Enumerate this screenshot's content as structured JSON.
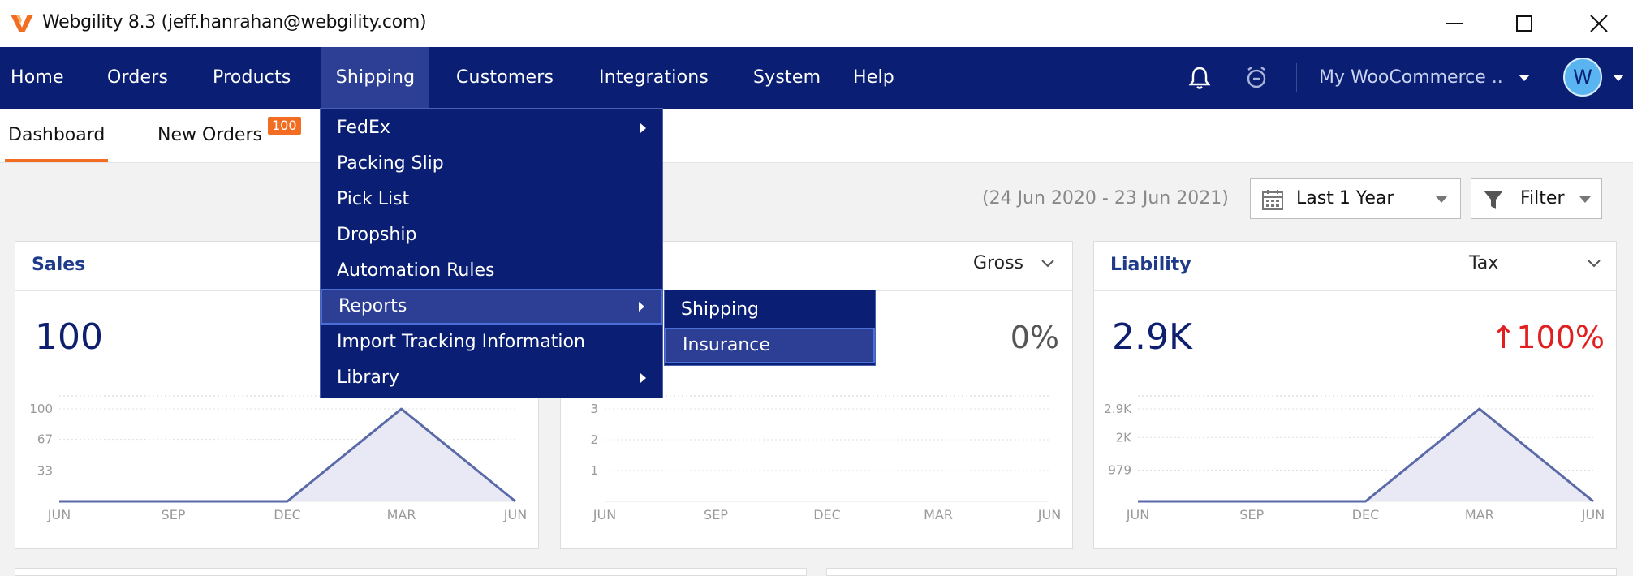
{
  "window": {
    "title": "Webgility 8.3 (jeff.hanrahan@webgility.com)"
  },
  "nav": {
    "items": [
      "Home",
      "Orders",
      "Products",
      "Shipping",
      "Customers",
      "Integrations",
      "System",
      "Help"
    ],
    "active": "Shipping",
    "store": "My WooCommerce ..",
    "avatar": "W"
  },
  "tabs": [
    {
      "label": "Dashboard",
      "active": true
    },
    {
      "label": "New Orders",
      "badge": "100"
    }
  ],
  "toolbar": {
    "date_range": "(24 Jun 2020 - 23 Jun 2021)",
    "period": "Last 1 Year",
    "filter": "Filter"
  },
  "shipping_menu": {
    "items": [
      {
        "label": "FedEx",
        "submenu": true
      },
      {
        "label": "Packing Slip"
      },
      {
        "label": "Pick List"
      },
      {
        "label": "Dropship"
      },
      {
        "label": "Automation Rules"
      },
      {
        "label": "Reports",
        "submenu": true,
        "highlighted": true
      },
      {
        "label": "Import Tracking Information"
      },
      {
        "label": "Library",
        "submenu": true
      }
    ]
  },
  "reports_submenu": {
    "items": [
      {
        "label": "Shipping"
      },
      {
        "label": "Insurance",
        "highlighted": true
      }
    ]
  },
  "cards": {
    "sales": {
      "title": "Sales",
      "value": "100"
    },
    "gross": {
      "selector": "Gross",
      "percent": "0%"
    },
    "liability": {
      "title": "Liability",
      "selector": "Tax",
      "value": "2.9K",
      "percent": "↑100%"
    }
  },
  "colors": {
    "nav_bg": "#0a1f73",
    "accent": "#f26d21",
    "line": "#5a6aa8",
    "area": "#e8e9f5",
    "up_red": "#e02020"
  },
  "chart_data": [
    {
      "type": "area",
      "card": "Sales",
      "x": [
        "JUN",
        "SEP",
        "DEC",
        "MAR",
        "JUN"
      ],
      "y_ticks": [
        "33",
        "67",
        "100"
      ],
      "ylim": [
        0,
        100
      ],
      "series": [
        {
          "points": [
            [
              0,
              0
            ],
            [
              2,
              0
            ],
            [
              3,
              100
            ],
            [
              4,
              0
            ]
          ]
        }
      ]
    },
    {
      "type": "area",
      "card": "Gross",
      "x": [
        "JUN",
        "SEP",
        "DEC",
        "MAR",
        "JUN"
      ],
      "y_ticks": [
        "1",
        "2",
        "3"
      ],
      "ylim": [
        0,
        3
      ],
      "series": []
    },
    {
      "type": "area",
      "card": "Liability",
      "x": [
        "JUN",
        "SEP",
        "DEC",
        "MAR",
        "JUN"
      ],
      "y_ticks": [
        "979",
        "2K",
        "2.9K"
      ],
      "ylim": [
        0,
        2900
      ],
      "series": [
        {
          "points": [
            [
              0,
              0
            ],
            [
              2,
              0
            ],
            [
              3,
              2900
            ],
            [
              4,
              0
            ]
          ]
        }
      ]
    }
  ]
}
